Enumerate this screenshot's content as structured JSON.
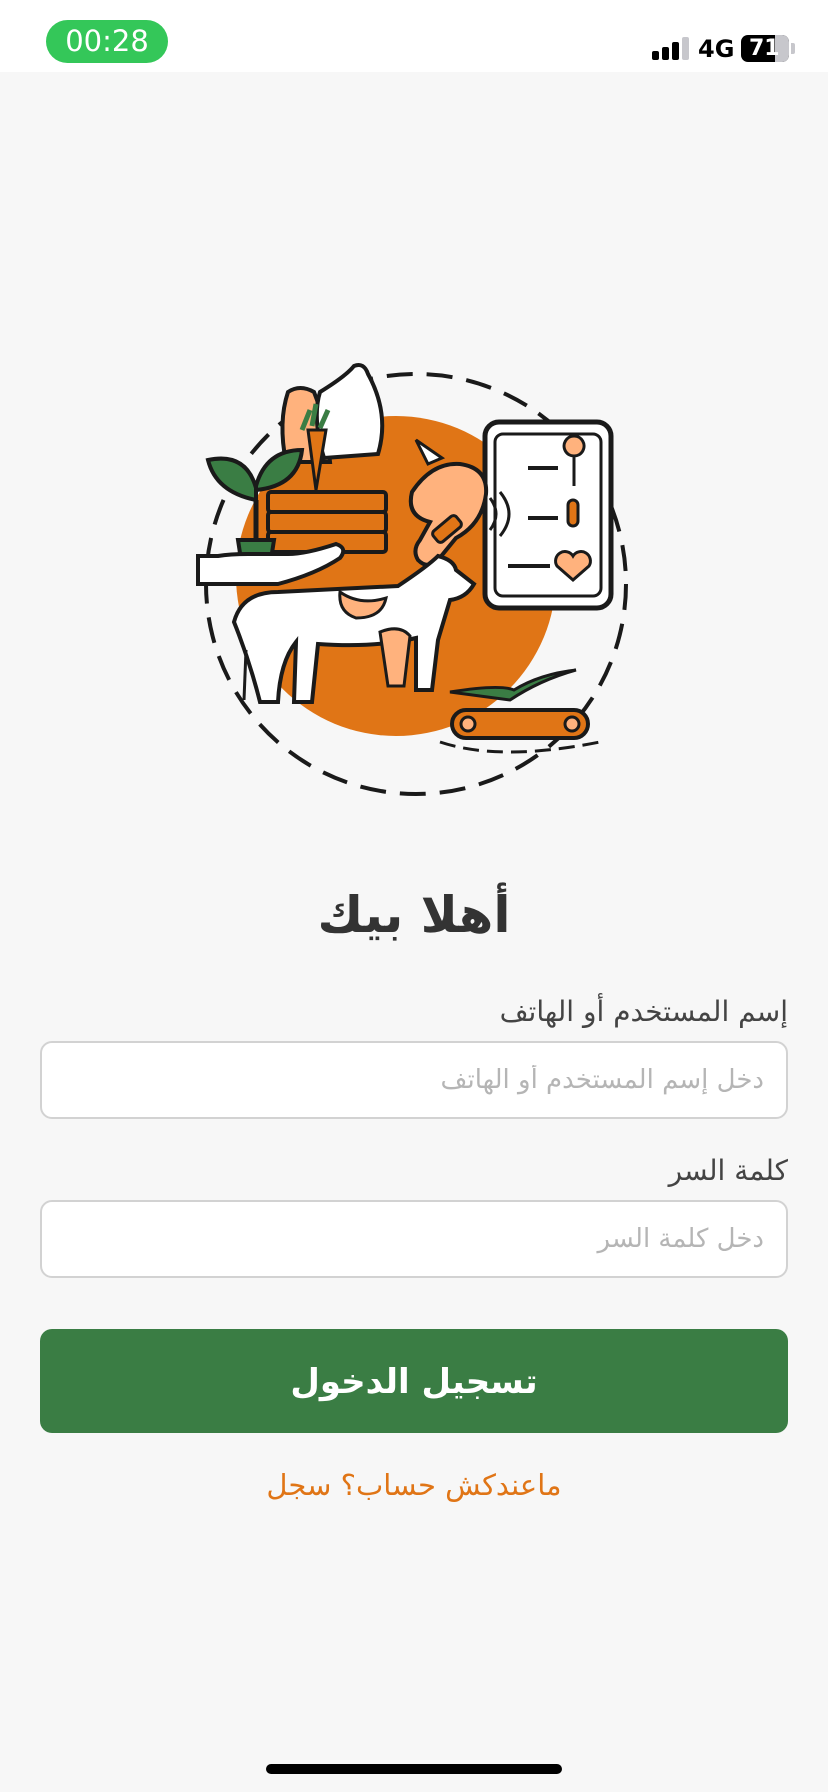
{
  "status_bar": {
    "time": "00:28",
    "network": "4G",
    "battery": "71",
    "signal_bars_active": 3,
    "signal_bars_total": 4,
    "time_pill_color": "#34c759"
  },
  "illustration": {
    "icon": "agriculture-livestock-illustration",
    "accent_color": "#e07516",
    "secondary_color": "#ffb27d",
    "green_color": "#3a7d44"
  },
  "login": {
    "title": "أهلا بيك",
    "username_label": "إسم المستخدم أو الهاتف",
    "username_placeholder": "دخل إسم المستخدم أو الهاتف",
    "username_value": "",
    "password_label": "كلمة السر",
    "password_placeholder": "دخل كلمة السر",
    "password_value": "",
    "submit_label": "تسجيل الدخول",
    "register_link": "ماعندكش حساب؟ سجل"
  },
  "colors": {
    "primary": "#3a7d44",
    "link": "#e07516",
    "background": "#f7f7f7"
  }
}
